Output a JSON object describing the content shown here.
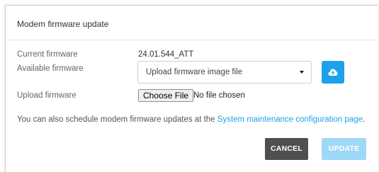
{
  "dialog": {
    "title": "Modem firmware update"
  },
  "current_firmware": {
    "label": "Current firmware",
    "value": "24.01.544_ATT"
  },
  "available_firmware": {
    "label": "Available firmware",
    "selected": "Upload firmware image file",
    "upload_icon": "cloud-upload-icon"
  },
  "upload_firmware": {
    "label": "Upload firmware",
    "button_label": "Choose File",
    "status": "No file chosen"
  },
  "info": {
    "text": "You can also schedule modem firmware updates at the ",
    "link": "System maintenance configuration page",
    "suffix": "."
  },
  "actions": {
    "cancel": "CANCEL",
    "update": "UPDATE"
  },
  "colors": {
    "accent": "#1aa3e8",
    "accent_disabled": "#9fd8f6",
    "cancel_bg": "#4f4f4f"
  }
}
